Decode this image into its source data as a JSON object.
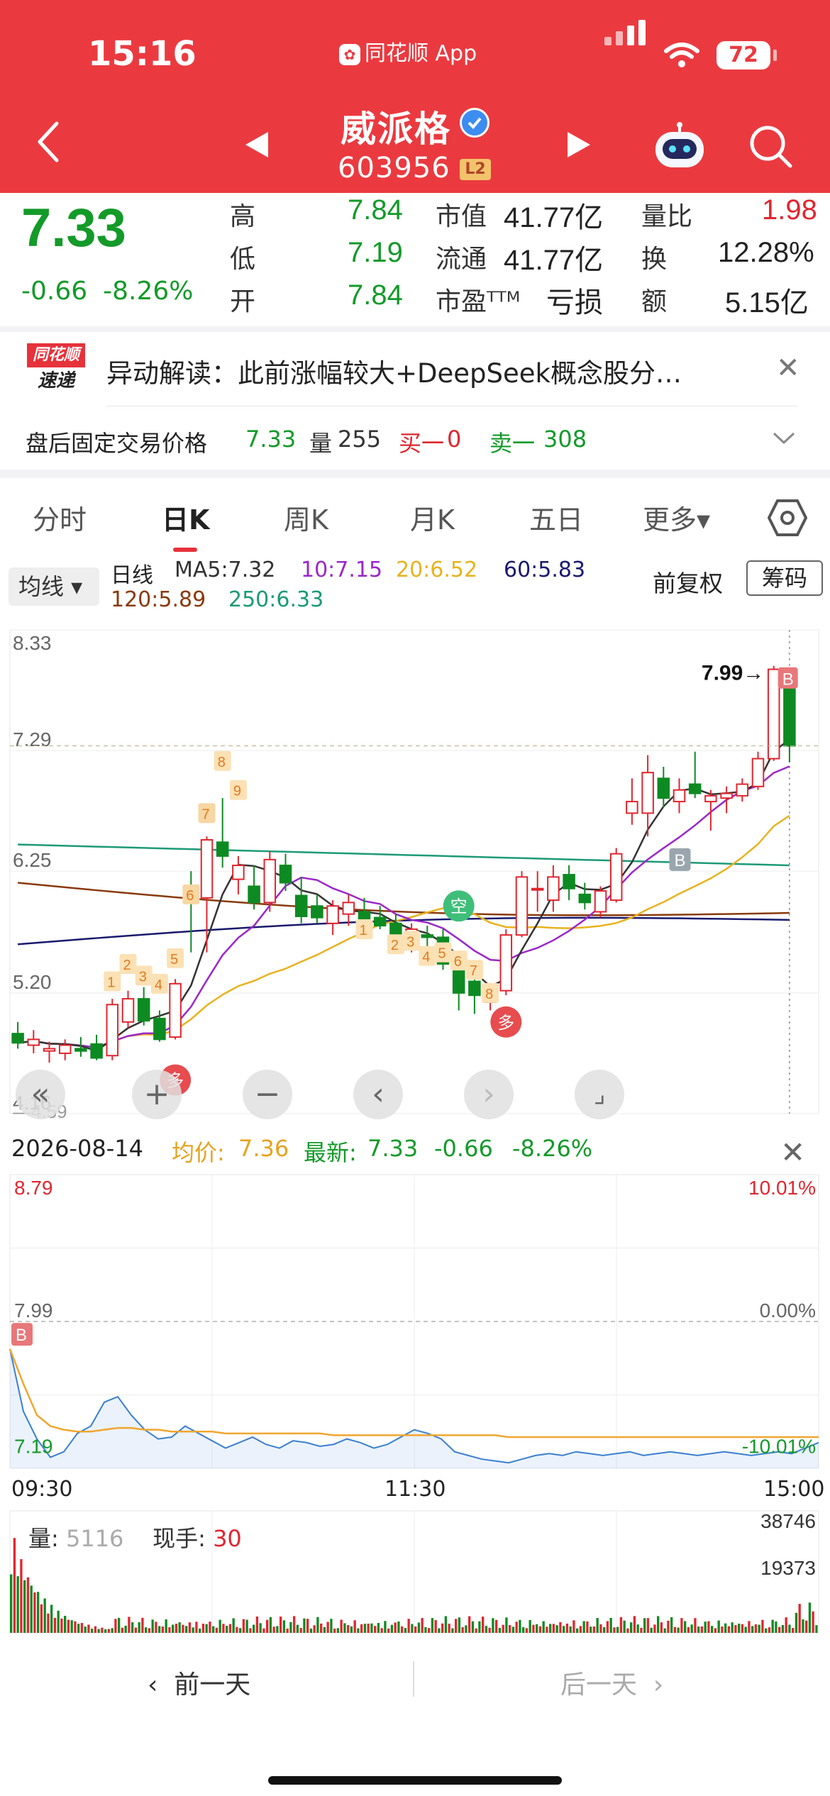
{
  "status_bar": {
    "time": "15:16",
    "app_label": "同花顺 App",
    "battery": "72"
  },
  "stock": {
    "name": "威派格",
    "code": "603956",
    "level_badge": "L2"
  },
  "quote": {
    "price": "7.33",
    "change": "-0.66",
    "change_pct": "-8.26%",
    "high_label": "高",
    "high": "7.84",
    "low_label": "低",
    "low": "7.19",
    "open_label": "开",
    "open": "7.84",
    "mktcap_label": "市值",
    "mktcap": "41.77亿",
    "float_label": "流通",
    "float": "41.77亿",
    "pe_label": "市盈ᵀᵀᴹ",
    "pe": "亏损",
    "vol_ratio_label": "量比",
    "vol_ratio": "1.98",
    "turnover_label": "换",
    "turnover": "12.28%",
    "amount_label": "额",
    "amount": "5.15亿"
  },
  "news": {
    "logo_top": "同花顺",
    "logo_bottom": "速递",
    "text": "异动解读：此前涨幅较大+DeepSeek概念股分…"
  },
  "afterhours": {
    "label": "盘后固定交易价格",
    "price": "7.33",
    "vol_label": "量",
    "vol": "255",
    "bid_label": "买一",
    "bid": "0",
    "ask_label": "卖一",
    "ask": "308"
  },
  "tabs": [
    {
      "label": "分时"
    },
    {
      "label": "日K"
    },
    {
      "label": "周K"
    },
    {
      "label": "月K"
    },
    {
      "label": "五日"
    },
    {
      "label": "更多▾"
    }
  ],
  "ma": {
    "selector": "均线 ▾",
    "period": "日线",
    "ma5": "MA5:7.32",
    "ma10": "10:7.15",
    "ma20": "20:6.52",
    "ma60": "60:5.83",
    "ma120": "120:5.89",
    "ma250": "250:6.33",
    "adjust": "前复权",
    "chips": "筹码",
    "colors": {
      "ma5": "#333333",
      "ma10": "#9b27c9",
      "ma20": "#e8b21f",
      "ma60": "#1a1a6e",
      "ma120": "#8a3a0c",
      "ma250": "#1c9a77"
    }
  },
  "kline_labels": {
    "y_top": "8.33",
    "y_mid1": "7.29",
    "y_mid2": "6.25",
    "y_mid3": "5.20",
    "y_bottom": "4.16",
    "low_mark": "4.59",
    "high_mark": "7.99→",
    "signal_b": "B",
    "signal_duo": "多",
    "signal_kong": "空",
    "sequence_numbers": [
      "1",
      "2",
      "3",
      "4",
      "5",
      "6",
      "7",
      "8",
      "9"
    ]
  },
  "chart_data": {
    "type": "candlestick",
    "ylim": [
      4.16,
      8.33
    ],
    "yticks": [
      8.33,
      7.29,
      6.25,
      5.2,
      4.16
    ],
    "candles": [
      {
        "o": 4.85,
        "h": 4.95,
        "l": 4.72,
        "c": 4.77
      },
      {
        "o": 4.75,
        "h": 4.88,
        "l": 4.68,
        "c": 4.8
      },
      {
        "o": 4.7,
        "h": 4.78,
        "l": 4.6,
        "c": 4.72
      },
      {
        "o": 4.68,
        "h": 4.8,
        "l": 4.62,
        "c": 4.75
      },
      {
        "o": 4.72,
        "h": 4.82,
        "l": 4.65,
        "c": 4.7
      },
      {
        "o": 4.76,
        "h": 4.84,
        "l": 4.62,
        "c": 4.64
      },
      {
        "o": 4.66,
        "h": 5.15,
        "l": 4.62,
        "c": 5.1
      },
      {
        "o": 4.95,
        "h": 5.22,
        "l": 4.9,
        "c": 5.15
      },
      {
        "o": 5.15,
        "h": 5.25,
        "l": 4.92,
        "c": 4.96
      },
      {
        "o": 4.98,
        "h": 5.05,
        "l": 4.78,
        "c": 4.8
      },
      {
        "o": 4.82,
        "h": 5.32,
        "l": 4.8,
        "c": 5.28
      },
      {
        "o": 6.05,
        "h": 6.25,
        "l": 5.55,
        "c": 6.02
      },
      {
        "o": 6.02,
        "h": 6.55,
        "l": 5.55,
        "c": 6.52
      },
      {
        "o": 6.5,
        "h": 6.88,
        "l": 6.28,
        "c": 6.38
      },
      {
        "o": 6.18,
        "h": 6.38,
        "l": 6.05,
        "c": 6.3
      },
      {
        "o": 6.12,
        "h": 6.3,
        "l": 5.92,
        "c": 5.98
      },
      {
        "o": 5.98,
        "h": 6.42,
        "l": 5.9,
        "c": 6.35
      },
      {
        "o": 6.3,
        "h": 6.4,
        "l": 6.08,
        "c": 6.15
      },
      {
        "o": 6.04,
        "h": 6.2,
        "l": 5.8,
        "c": 5.86
      },
      {
        "o": 5.95,
        "h": 6.05,
        "l": 5.8,
        "c": 5.85
      },
      {
        "o": 5.8,
        "h": 6.0,
        "l": 5.7,
        "c": 5.95
      },
      {
        "o": 5.88,
        "h": 6.05,
        "l": 5.78,
        "c": 5.98
      },
      {
        "o": 5.9,
        "h": 6.02,
        "l": 5.8,
        "c": 5.82
      },
      {
        "o": 5.85,
        "h": 5.95,
        "l": 5.75,
        "c": 5.78
      },
      {
        "o": 5.8,
        "h": 5.88,
        "l": 5.6,
        "c": 5.65
      },
      {
        "o": 5.65,
        "h": 5.8,
        "l": 5.55,
        "c": 5.75
      },
      {
        "o": 5.7,
        "h": 5.78,
        "l": 5.6,
        "c": 5.68
      },
      {
        "o": 5.68,
        "h": 5.75,
        "l": 5.4,
        "c": 5.45
      },
      {
        "o": 5.45,
        "h": 5.5,
        "l": 5.05,
        "c": 5.2
      },
      {
        "o": 5.3,
        "h": 5.4,
        "l": 5.02,
        "c": 5.18
      },
      {
        "o": 5.12,
        "h": 5.22,
        "l": 5.05,
        "c": 5.2
      },
      {
        "o": 5.22,
        "h": 5.75,
        "l": 5.18,
        "c": 5.7
      },
      {
        "o": 5.7,
        "h": 6.25,
        "l": 5.68,
        "c": 6.2
      },
      {
        "o": 6.1,
        "h": 6.25,
        "l": 5.9,
        "c": 6.1
      },
      {
        "o": 6.0,
        "h": 6.3,
        "l": 5.9,
        "c": 6.2
      },
      {
        "o": 6.22,
        "h": 6.3,
        "l": 6.0,
        "c": 6.1
      },
      {
        "o": 6.05,
        "h": 6.15,
        "l": 5.92,
        "c": 5.98
      },
      {
        "o": 5.9,
        "h": 6.12,
        "l": 5.85,
        "c": 6.08
      },
      {
        "o": 6.0,
        "h": 6.45,
        "l": 5.98,
        "c": 6.4
      },
      {
        "o": 6.75,
        "h": 7.05,
        "l": 6.65,
        "c": 6.85
      },
      {
        "o": 6.75,
        "h": 7.25,
        "l": 6.55,
        "c": 7.1
      },
      {
        "o": 7.05,
        "h": 7.15,
        "l": 6.8,
        "c": 6.88
      },
      {
        "o": 6.85,
        "h": 7.05,
        "l": 6.75,
        "c": 6.95
      },
      {
        "o": 7.0,
        "h": 7.28,
        "l": 6.88,
        "c": 6.92
      },
      {
        "o": 6.85,
        "h": 6.95,
        "l": 6.6,
        "c": 6.9
      },
      {
        "o": 6.88,
        "h": 6.98,
        "l": 6.75,
        "c": 6.92
      },
      {
        "o": 6.9,
        "h": 7.05,
        "l": 6.85,
        "c": 7.0
      },
      {
        "o": 6.98,
        "h": 7.28,
        "l": 6.95,
        "c": 7.22
      },
      {
        "o": 7.22,
        "h": 8.02,
        "l": 7.2,
        "c": 7.99
      },
      {
        "o": 7.84,
        "h": 7.84,
        "l": 7.19,
        "c": 7.33
      }
    ]
  },
  "intraday_labels": {
    "date": "2026-08-14",
    "avg_label": "均价:",
    "avg": "7.36",
    "latest_label": "最新:",
    "latest": "7.33",
    "chg": "-0.66",
    "chg_pct": "-8.26%",
    "y_top": "8.79",
    "y_mid": "7.99",
    "y_bot": "7.19",
    "pct_top": "10.01%",
    "pct_mid": "0.00%",
    "pct_bot": "-10.01%",
    "t_start": "09:30",
    "t_mid": "11:30",
    "t_end": "15:00",
    "vol_label": "量:",
    "vol": "5116",
    "hand_label": "现手:",
    "hand": "30",
    "vol_max": "38746",
    "vol_half": "19373"
  },
  "intraday_data": {
    "ylim": [
      7.19,
      8.79
    ],
    "price": [
      7.84,
      7.5,
      7.35,
      7.25,
      7.28,
      7.38,
      7.42,
      7.55,
      7.58,
      7.48,
      7.4,
      7.35,
      7.36,
      7.42,
      7.38,
      7.34,
      7.3,
      7.33,
      7.36,
      7.32,
      7.3,
      7.34,
      7.33,
      7.31,
      7.32,
      7.35,
      7.33,
      7.3,
      7.32,
      7.36,
      7.4,
      7.38,
      7.35,
      7.28,
      7.26,
      7.24,
      7.23,
      7.22,
      7.24,
      7.26,
      7.27,
      7.26,
      7.28,
      7.27,
      7.26,
      7.27,
      7.28,
      7.26,
      7.27,
      7.28,
      7.27,
      7.26,
      7.27,
      7.28,
      7.27,
      7.26,
      7.27,
      7.28,
      7.27,
      7.3,
      7.33
    ],
    "avg": [
      7.84,
      7.65,
      7.48,
      7.42,
      7.4,
      7.39,
      7.39,
      7.4,
      7.41,
      7.41,
      7.4,
      7.4,
      7.39,
      7.39,
      7.39,
      7.39,
      7.38,
      7.38,
      7.38,
      7.38,
      7.38,
      7.38,
      7.38,
      7.38,
      7.37,
      7.37,
      7.37,
      7.37,
      7.37,
      7.37,
      7.37,
      7.37,
      7.37,
      7.37,
      7.37,
      7.37,
      7.37,
      7.36,
      7.36,
      7.36,
      7.36,
      7.36,
      7.36,
      7.36,
      7.36,
      7.36,
      7.36,
      7.36,
      7.36,
      7.36,
      7.36,
      7.36,
      7.36,
      7.36,
      7.36,
      7.36,
      7.36,
      7.36,
      7.36,
      7.36,
      7.36
    ]
  },
  "day_nav": {
    "prev": "前一天",
    "next": "后一天"
  }
}
